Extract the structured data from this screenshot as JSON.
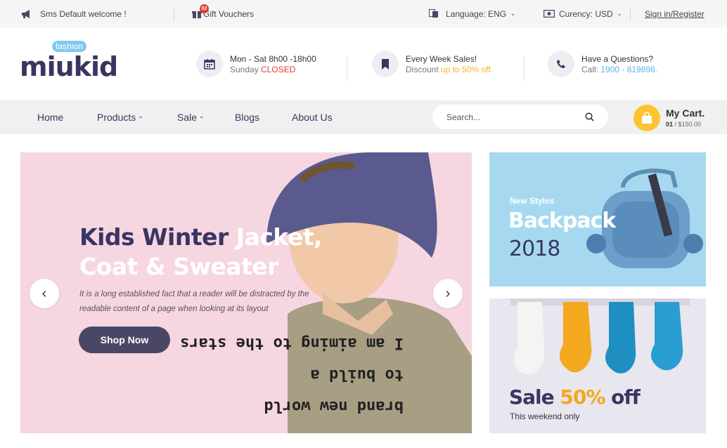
{
  "topbar": {
    "welcome": "Sms Default welcome !",
    "vouchers_badge": "02",
    "vouchers": "Gift Vouchers",
    "language": "Language: ENG",
    "currency": "Curency: USD",
    "signin": "Sign in/Register"
  },
  "logo": {
    "tag": "fashion",
    "word": "miukid"
  },
  "info": {
    "hours": {
      "line1": "Mon - Sat 8h00 -18h00",
      "line2_prefix": "Sunday ",
      "line2_highlight": "CLOSED"
    },
    "sales": {
      "line1": "Every Week Sales!",
      "line2_prefix": "Discount ",
      "line2_highlight": "up to 50% off."
    },
    "help": {
      "line1": "Have a Questions?",
      "line2_prefix": "Call: ",
      "line2_highlight": "1900 - 819898."
    }
  },
  "nav": {
    "items": [
      {
        "label": "Home"
      },
      {
        "label": "Products"
      },
      {
        "label": "Sale"
      },
      {
        "label": "Blogs"
      },
      {
        "label": "About Us"
      }
    ],
    "search_placeholder": "Search...",
    "cart_title": "My Cart.",
    "cart_count": "01",
    "cart_total": " / $150.00"
  },
  "hero": {
    "title_dark": "Kids Winter",
    "title_light1": " Jacket,",
    "title_light2": "Coat & Sweater",
    "desc": "It is a long established fact that a reader will be distracted by the readable content of a page when looking at its layout",
    "button": "Shop Now",
    "shirt_text": "I am aiming to the stars to build a brand new world"
  },
  "banner1": {
    "kicker": "New Styles",
    "title": "Backpack",
    "year": "2018"
  },
  "banner2": {
    "sale": "Sale ",
    "pct": "50%",
    "off": " off",
    "sub": "This weekend only"
  },
  "colors": {
    "brand_dark": "#3a3560",
    "accent_yellow": "#fbc531",
    "accent_red": "#e43b3b",
    "accent_blue": "#55b5e8",
    "hero_bg": "#f6d6e0"
  }
}
